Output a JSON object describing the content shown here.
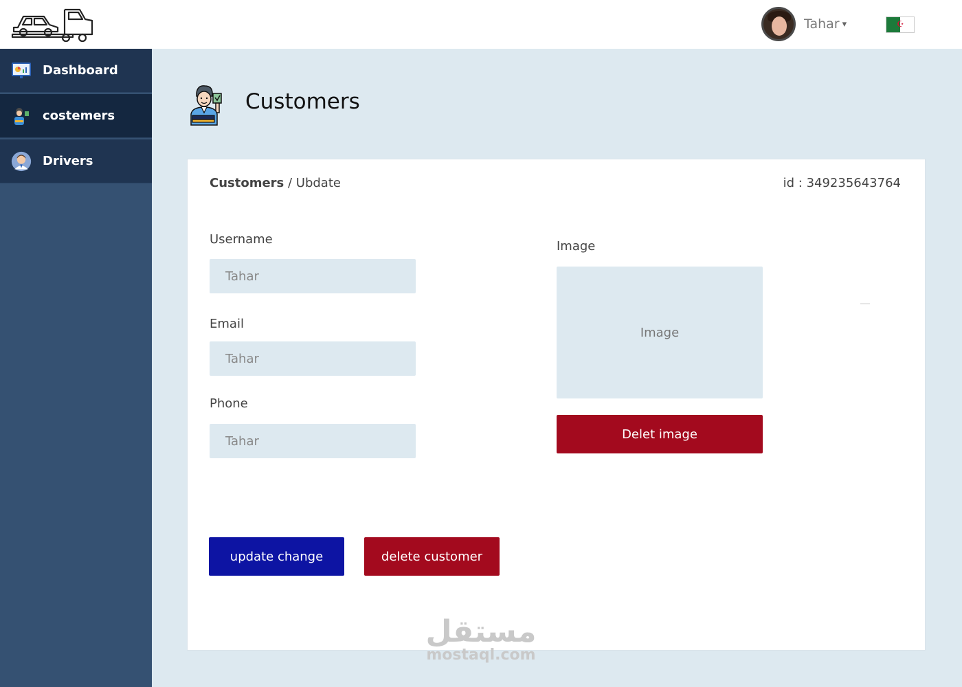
{
  "header": {
    "user_name": "Tahar",
    "caret": "▾"
  },
  "sidebar": {
    "items": [
      {
        "label": "Dashboard",
        "icon": "dashboard-icon"
      },
      {
        "label": "costemers",
        "icon": "customer-icon",
        "active": true
      },
      {
        "label": "Drivers",
        "icon": "driver-icon"
      }
    ]
  },
  "page": {
    "title": "Customers"
  },
  "card": {
    "breadcrumb": {
      "parent": "Customers",
      "separator": " / ",
      "current": "Ubdate"
    },
    "id_label": "id : ",
    "id_value": "349235643764",
    "fields": {
      "username": {
        "label": "Username",
        "value": "Tahar"
      },
      "email": {
        "label": "Email",
        "value": "Tahar"
      },
      "phone": {
        "label": "Phone",
        "value": "Tahar"
      }
    },
    "image": {
      "label": "Image",
      "placeholder": "Image",
      "delete_label": "Delet image"
    },
    "actions": {
      "update_label": "update change",
      "delete_label": "delete customer"
    }
  },
  "watermark": {
    "arabic": "مستقل",
    "latin": "mostaql.com"
  },
  "colors": {
    "sidebar": "#355172",
    "nav_item": "#1f3451",
    "nav_active": "#142740",
    "background": "#dde9f0",
    "primary_button": "#0d14a3",
    "danger_button": "#a30a1e"
  }
}
